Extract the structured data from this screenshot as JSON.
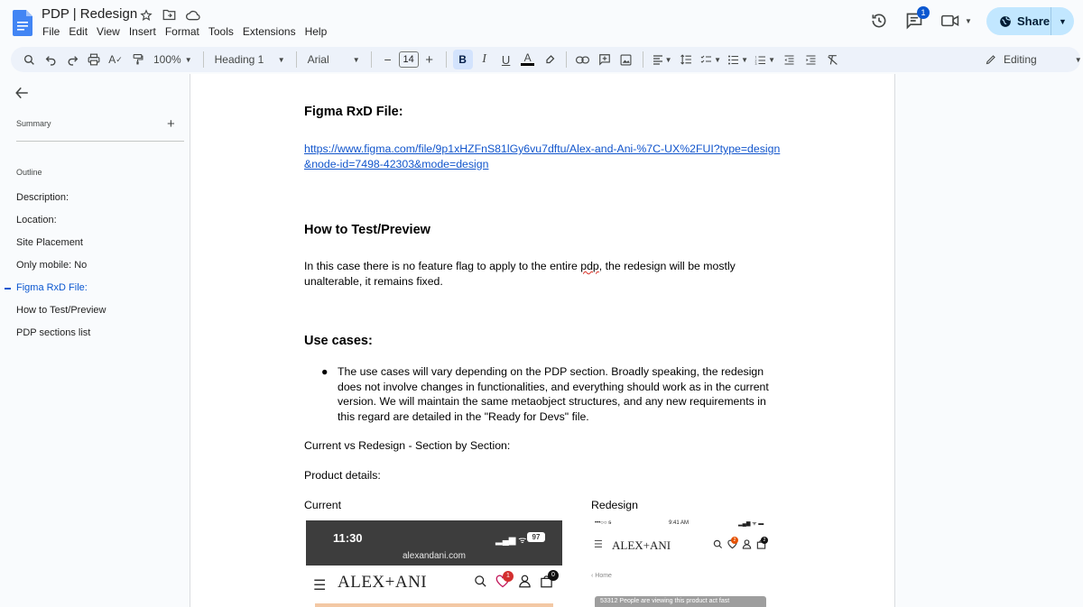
{
  "doc": {
    "title": "PDP | Redesign"
  },
  "menu": [
    "File",
    "Edit",
    "View",
    "Insert",
    "Format",
    "Tools",
    "Extensions",
    "Help"
  ],
  "header": {
    "comments_badge": "1",
    "share_label": "Share"
  },
  "toolbar": {
    "zoom": "100%",
    "style": "Heading 1",
    "font": "Arial",
    "font_size": "14",
    "mode": "Editing"
  },
  "sidebar": {
    "summary_label": "Summary",
    "outline_label": "Outline",
    "outline": [
      "Description:",
      "Location:",
      "Site Placement",
      "Only mobile: No",
      "Figma RxD File:",
      "How to Test/Preview",
      "PDP sections list"
    ],
    "active_index": 4
  },
  "content": {
    "figma_heading": "Figma RxD File:",
    "figma_link_1": "https://www.figma.com/file/9p1xHZFnS81lGy6vu7dftu/Alex-and-Ani-%7C-UX%2FUI?type=design",
    "figma_link_2": "&node-id=7498-42303&mode=design",
    "test_heading": "How to Test/Preview",
    "test_p1a": "In this case there is no feature flag to apply to the entire ",
    "test_p1_spell": "pdp",
    "test_p1b": ", the redesign will be mostly",
    "test_p2": "unalterable, it remains fixed.",
    "usecases_heading": "Use cases:",
    "bullet": "●",
    "bullet_l1": "The use cases will vary depending on the PDP section. Broadly speaking, the redesign",
    "bullet_l2": "does not involve changes in functionalities, and everything should work as in the current",
    "bullet_l3": "version. We will maintain the same metaobject structures, and any new requirements in",
    "bullet_l4": "this regard are detailed in the \"Ready for Devs\" file.",
    "compare": "Current vs Redesign - Section by Section:",
    "product_details": "Product details:",
    "current_label": "Current",
    "redesign_label": "Redesign"
  },
  "screenshot_current": {
    "time": "11:30",
    "battery": "97",
    "url": "alexandani.com",
    "brand": "ALEX+ANI",
    "wishlist_count": "1",
    "cart_count": "0"
  },
  "screenshot_redesign": {
    "carrier": "•••○○ ᵴ",
    "time": "9:41 AM",
    "brand": "ALEX+ANI",
    "wishlist_count": "2",
    "cart_count": "2",
    "breadcrumb": "‹  Home",
    "banner": "53312 People are viewing this product act fast"
  }
}
